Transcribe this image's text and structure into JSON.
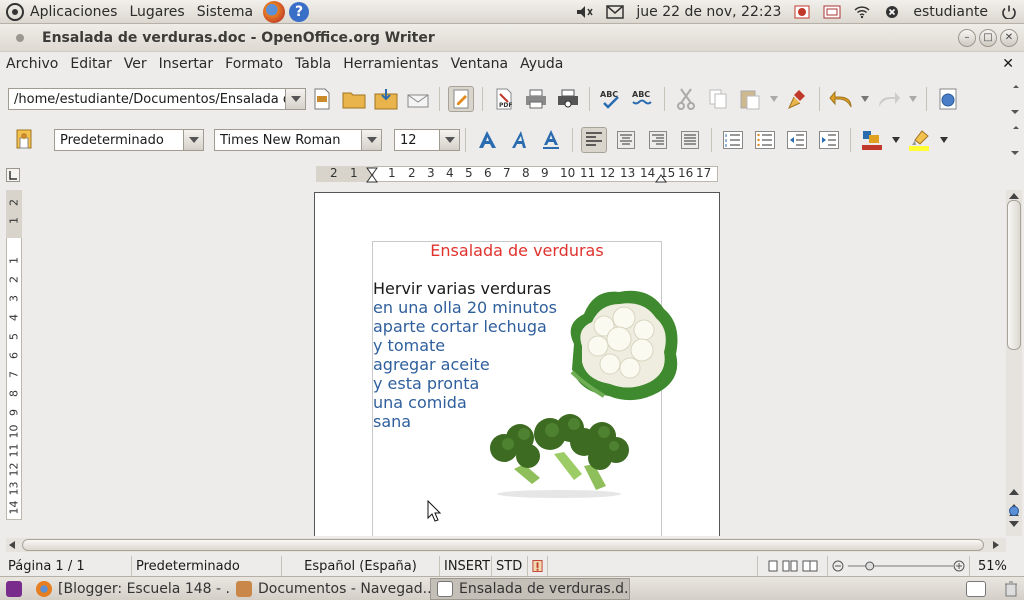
{
  "top_panel": {
    "menus": [
      "Aplicaciones",
      "Lugares",
      "Sistema"
    ],
    "clock": "jue 22 de nov, 22:23",
    "user": "estudiante"
  },
  "window": {
    "title": "Ensalada de verduras.doc - OpenOffice.org Writer"
  },
  "menu_bar": {
    "items": [
      "Archivo",
      "Editar",
      "Ver",
      "Insertar",
      "Formato",
      "Tabla",
      "Herramientas",
      "Ventana",
      "Ayuda"
    ]
  },
  "toolbar1": {
    "path": "/home/estudiante/Documentos/Ensalada de",
    "pdf_label": "PDF",
    "abc_label": "ABC"
  },
  "toolbar2": {
    "style": "Predeterminado",
    "font": "Times New Roman",
    "size": "12"
  },
  "ruler": {
    "h_numbers": [
      "2",
      "1",
      "1",
      "2",
      "3",
      "4",
      "5",
      "6",
      "7",
      "8",
      "9",
      "10",
      "11",
      "12",
      "13",
      "14",
      "15",
      "16",
      "17"
    ],
    "v_numbers": [
      "2",
      "1",
      "1",
      "2",
      "3",
      "4",
      "5",
      "6",
      "7",
      "8",
      "9",
      "10",
      "11",
      "12",
      "13",
      "14"
    ]
  },
  "document": {
    "title": "Ensalada de verduras",
    "lines": [
      "Hervir varias verduras",
      "en una olla 20 minutos",
      "aparte cortar lechuga",
      "y tomate",
      "agregar aceite",
      "y esta pronta",
      "una comida",
      "sana"
    ],
    "colors": {
      "title": "#e0332e",
      "first_line": "#1a1a1a",
      "body": "#2f5f9c"
    }
  },
  "status_bar": {
    "page": "Página  1 / 1",
    "style": "Predeterminado",
    "language": "Español (España)",
    "insert": "INSERT",
    "std": "STD",
    "zoom": "51%"
  },
  "taskbar": {
    "tasks": [
      "[Blogger: Escuela 148 - ...",
      "Documentos - Navegad...",
      "Ensalada de verduras.d..."
    ]
  }
}
